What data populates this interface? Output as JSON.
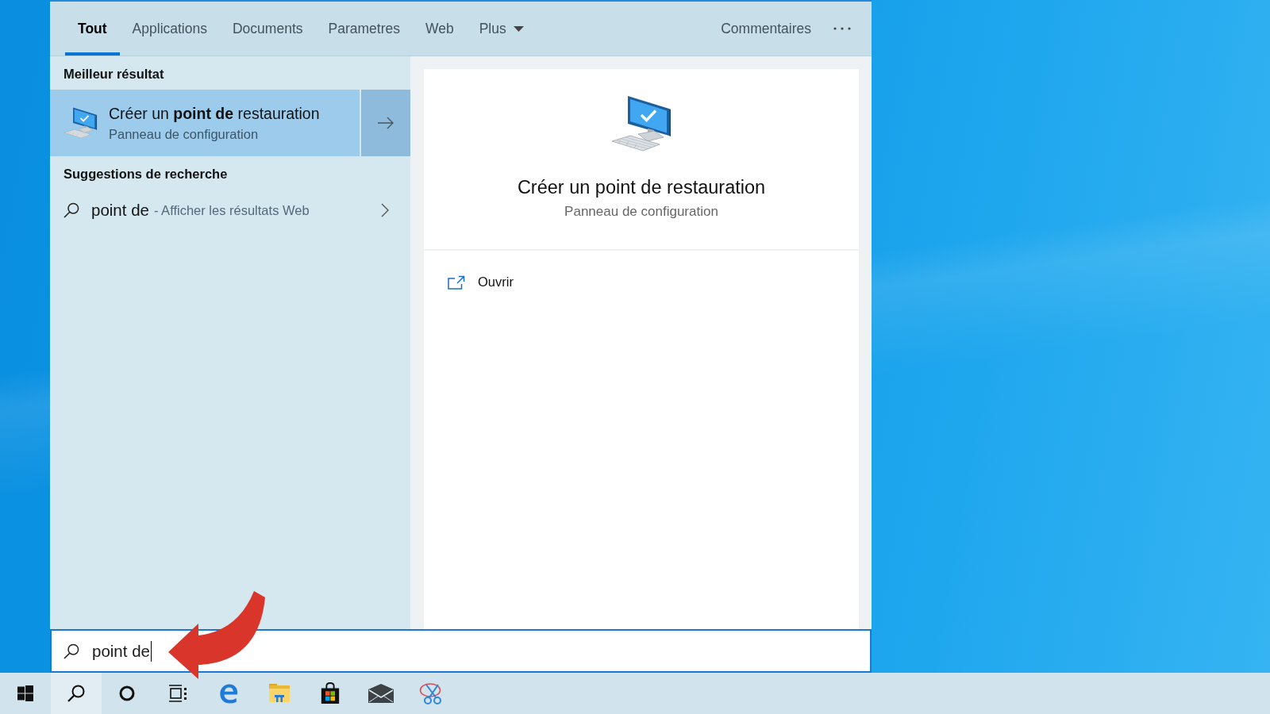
{
  "tabs": [
    {
      "label": "Tout",
      "selected": true,
      "kind": "tab"
    },
    {
      "label": "Applications",
      "selected": false,
      "kind": "tab"
    },
    {
      "label": "Documents",
      "selected": false,
      "kind": "tab"
    },
    {
      "label": "Parametres",
      "selected": false,
      "kind": "tab"
    },
    {
      "label": "Web",
      "selected": false,
      "kind": "tab"
    },
    {
      "label": "Plus",
      "selected": false,
      "kind": "menu"
    }
  ],
  "feedback_link": "Commentaires",
  "best_match": {
    "heading": "Meilleur résultat",
    "title": "Créer un **point de** restauration",
    "subtitle": "Panneau de configuration",
    "selected": true
  },
  "suggestions": {
    "heading": "Suggestions de recherche",
    "items": [
      {
        "query": "point de",
        "hint": "- Afficher les résultats Web",
        "selected": false
      }
    ]
  },
  "preview": {
    "title": "Créer un point de restauration",
    "subtitle": "Panneau de configuration",
    "actions": [
      {
        "label": "Ouvrir"
      }
    ]
  },
  "search_box": {
    "value": "point de",
    "focused": true
  },
  "taskbar": {
    "search_open": true
  }
}
